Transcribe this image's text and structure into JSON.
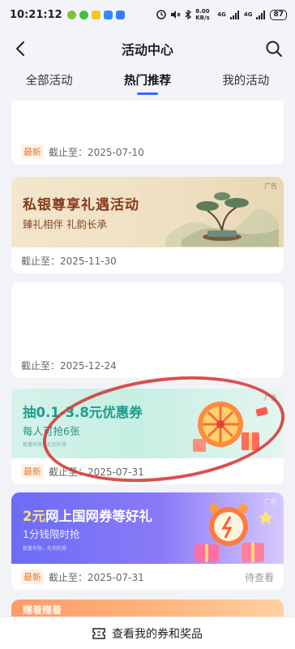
{
  "status_bar": {
    "time": "10:21:12",
    "network_speed": "8.00 KB/s",
    "signal1": "4G",
    "signal2": "4G",
    "battery": "87"
  },
  "header": {
    "title": "活动中心"
  },
  "tabs": [
    {
      "label": "全部活动",
      "active": false
    },
    {
      "label": "热门推荐",
      "active": true
    },
    {
      "label": "我的活动",
      "active": false
    }
  ],
  "cards": [
    {
      "badge": "最新",
      "deadline": "截止至：2025-07-10"
    },
    {
      "banner_title": "私银尊享礼遇活动",
      "banner_subtitle": "臻礼相伴 礼韵长承",
      "ad": "广告",
      "deadline": "截止至：2025-11-30"
    },
    {
      "deadline": "截止至：2025-12-24"
    },
    {
      "banner_title": "抽0.1-3.8元优惠券",
      "banner_subtitle": "每人可抢6张",
      "fine_print": "数量有限，先到先得",
      "ad": "广告",
      "badge": "最新",
      "deadline": "截止至：2025-07-31"
    },
    {
      "banner_title_highlight": "2元",
      "banner_title": "网上国网券等好礼",
      "banner_subtitle": "1分钱限时抢",
      "fine_print": "数量有限，先到先得",
      "ad": "广告",
      "badge": "最新",
      "deadline": "截止至：2025-07-31",
      "status": "待查看"
    },
    {
      "banner_title": "赚着赚着"
    }
  ],
  "bottom_bar": {
    "label": "查看我的券和奖品"
  },
  "colors": {
    "accent": "#2f6bff",
    "badge": "#e8792b",
    "annotation": "#d23232"
  }
}
